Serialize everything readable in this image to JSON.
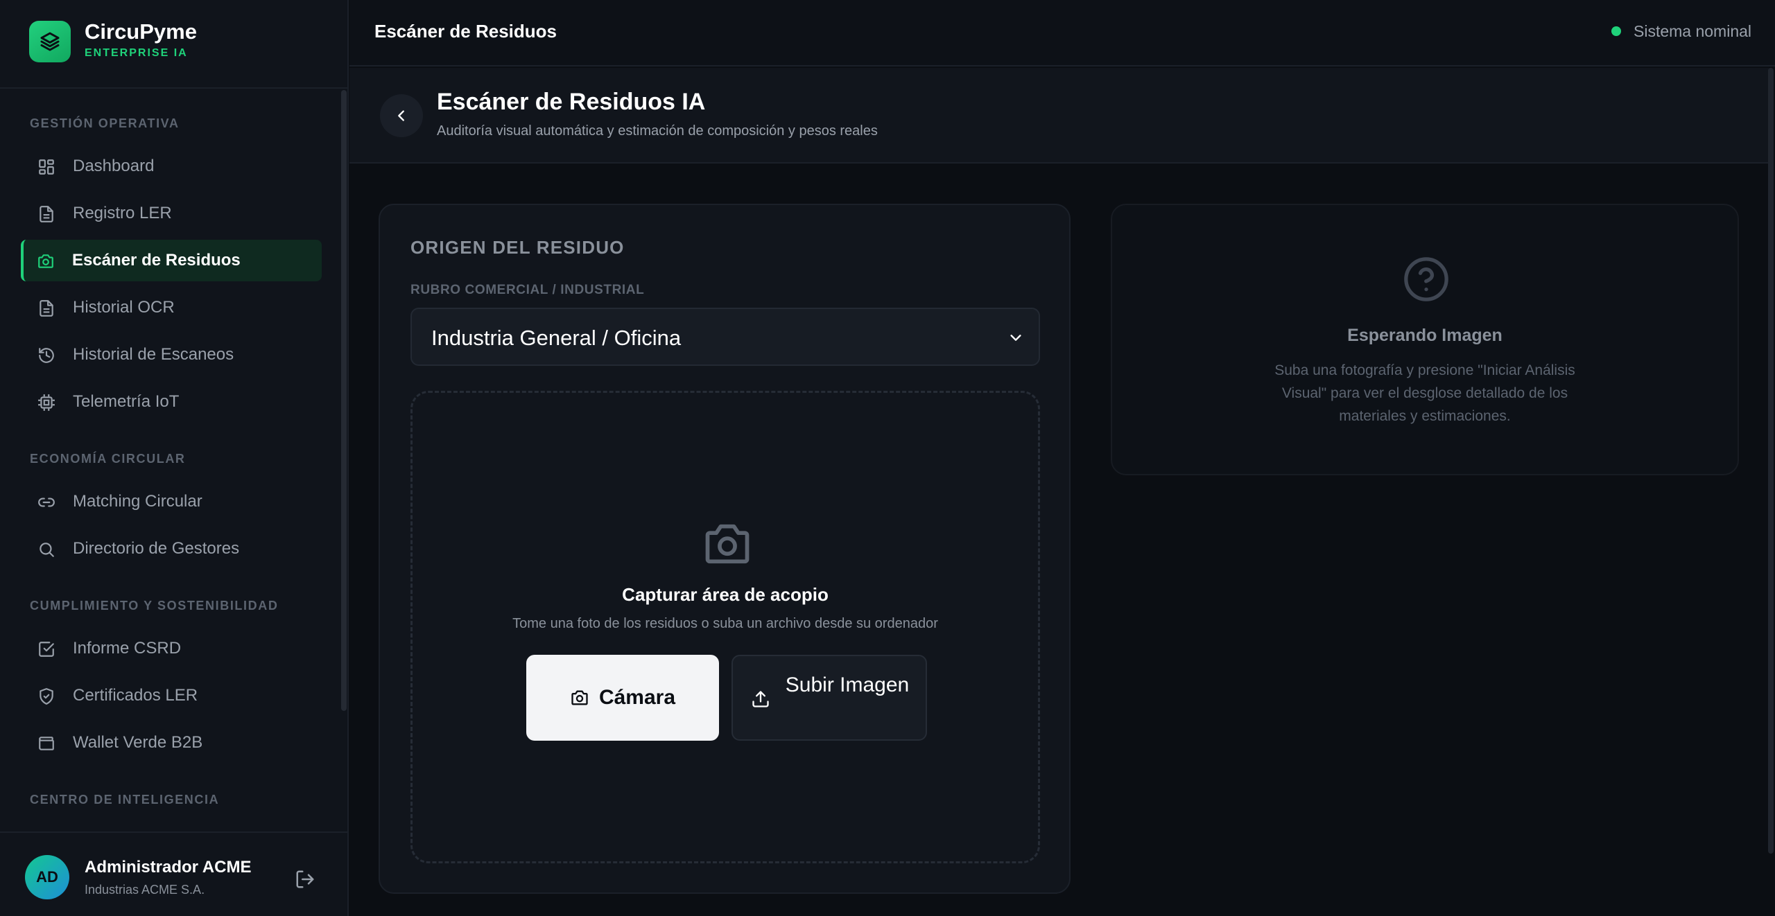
{
  "brand": {
    "name": "CircuPyme",
    "subtitle": "ENTERPRISE IA"
  },
  "sidebar": {
    "sections": [
      {
        "title": "GESTIÓN OPERATIVA"
      },
      {
        "title": "ECONOMÍA CIRCULAR"
      },
      {
        "title": "CUMPLIMIENTO Y SOSTENIBILIDAD"
      },
      {
        "title": "CENTRO DE INTELIGENCIA"
      }
    ],
    "items": [
      {
        "label": "Dashboard",
        "icon": "grid-icon"
      },
      {
        "label": "Registro LER",
        "icon": "document-icon"
      },
      {
        "label": "Escáner de Residuos",
        "icon": "camera-icon",
        "active": true
      },
      {
        "label": "Historial OCR",
        "icon": "document-icon"
      },
      {
        "label": "Historial de Escaneos",
        "icon": "history-icon"
      },
      {
        "label": "Telemetría IoT",
        "icon": "chip-icon"
      },
      {
        "label": "Matching Circular",
        "icon": "link-icon"
      },
      {
        "label": "Directorio de Gestores",
        "icon": "search-icon"
      },
      {
        "label": "Informe CSRD",
        "icon": "checkbox-icon"
      },
      {
        "label": "Certificados LER",
        "icon": "shield-check-icon"
      },
      {
        "label": "Wallet Verde B2B",
        "icon": "wallet-icon"
      }
    ]
  },
  "user": {
    "initials": "AD",
    "name": "Administrador ACME",
    "org": "Industrias ACME S.A."
  },
  "topbar": {
    "title": "Escáner de Residuos",
    "status": "Sistema nominal"
  },
  "page": {
    "title": "Escáner de Residuos IA",
    "subtitle": "Auditoría visual automática y estimación de composición y pesos reales"
  },
  "origin": {
    "title": "ORIGEN DEL RESIDUO",
    "field_label": "RUBRO COMERCIAL / INDUSTRIAL",
    "selected": "Industria General / Oficina"
  },
  "dropzone": {
    "title": "Capturar área de acopio",
    "subtitle": "Tome una foto de los residuos o suba un archivo desde su ordenador",
    "camera_label": "Cámara",
    "upload_label": "Subir Imagen"
  },
  "result": {
    "title": "Esperando Imagen",
    "text": "Suba una fotografía y presione \"Iniciar Análisis Visual\" para ver el desglose detallado de los materiales y estimaciones."
  },
  "colors": {
    "accent": "#1fd27a",
    "background": "#0b0e13",
    "panel": "#11151c"
  }
}
